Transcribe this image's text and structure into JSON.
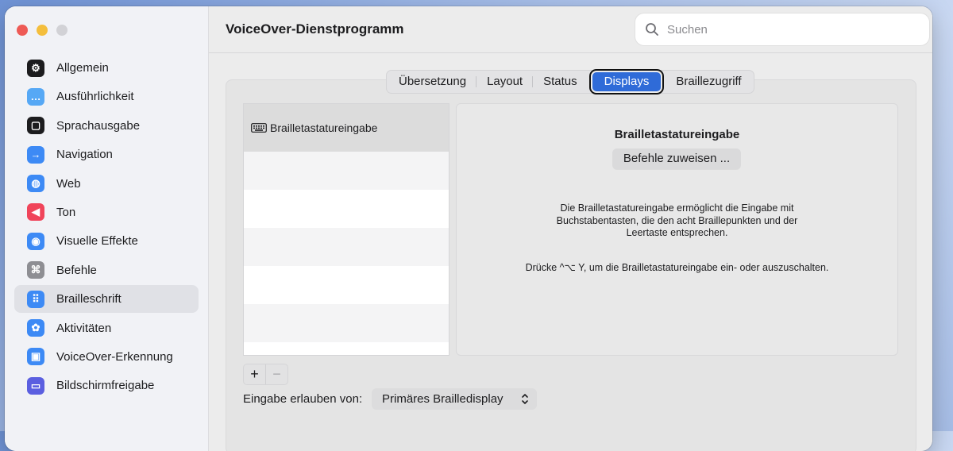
{
  "window": {
    "title": "VoiceOver-Dienstprogramm"
  },
  "search": {
    "placeholder": "Suchen"
  },
  "sidebar": {
    "items": [
      {
        "label": "Allgemein",
        "icon": "general-icon",
        "color": "#1c1c1e"
      },
      {
        "label": "Ausführlichkeit",
        "icon": "speech-bubble-icon",
        "color": "#56a8f5"
      },
      {
        "label": "Sprachausgabe",
        "icon": "speech-icon",
        "color": "#1c1c1e"
      },
      {
        "label": "Navigation",
        "icon": "arrow-right-icon",
        "color": "#3d8af5"
      },
      {
        "label": "Web",
        "icon": "globe-icon",
        "color": "#3d8af5"
      },
      {
        "label": "Ton",
        "icon": "speaker-icon",
        "color": "#f0445a"
      },
      {
        "label": "Visuelle Effekte",
        "icon": "eye-icon",
        "color": "#3d8af5"
      },
      {
        "label": "Befehle",
        "icon": "command-icon",
        "color": "#8e8e93"
      },
      {
        "label": "Brailleschrift",
        "icon": "braille-icon",
        "color": "#3d8af5"
      },
      {
        "label": "Aktivitäten",
        "icon": "activities-icon",
        "color": "#3d8af5"
      },
      {
        "label": "VoiceOver-Erkennung",
        "icon": "recognition-icon",
        "color": "#3d8af5"
      },
      {
        "label": "Bildschirmfreigabe",
        "icon": "screen-sharing-icon",
        "color": "#5b5fe0"
      }
    ],
    "selected_index": 8
  },
  "tabs": [
    {
      "label": "Übersetzung"
    },
    {
      "label": "Layout"
    },
    {
      "label": "Status"
    },
    {
      "label": "Displays",
      "active": true
    },
    {
      "label": "Braillezugriff"
    }
  ],
  "list": {
    "items": [
      {
        "label": "Brailletastatureingabe",
        "icon": "keyboard-icon"
      }
    ]
  },
  "detail": {
    "title": "Brailletastatureingabe",
    "assign_button": "Befehle zuweisen ...",
    "description": "Die Brailletastatureingabe ermöglicht die Eingabe mit Buchstabentasten, die den acht Braillepunkten und der Leertaste entsprechen.",
    "toggle_hint": "Drücke ^⌥  Y, um die Brailletastatureingabe ein- oder auszuschalten."
  },
  "controls": {
    "add_label": "+",
    "remove_label": "−",
    "allow_label": "Eingabe erlauben von:",
    "allow_value": "Primäres Brailledisplay"
  },
  "colors": {
    "accent": "#2f6bd8"
  }
}
